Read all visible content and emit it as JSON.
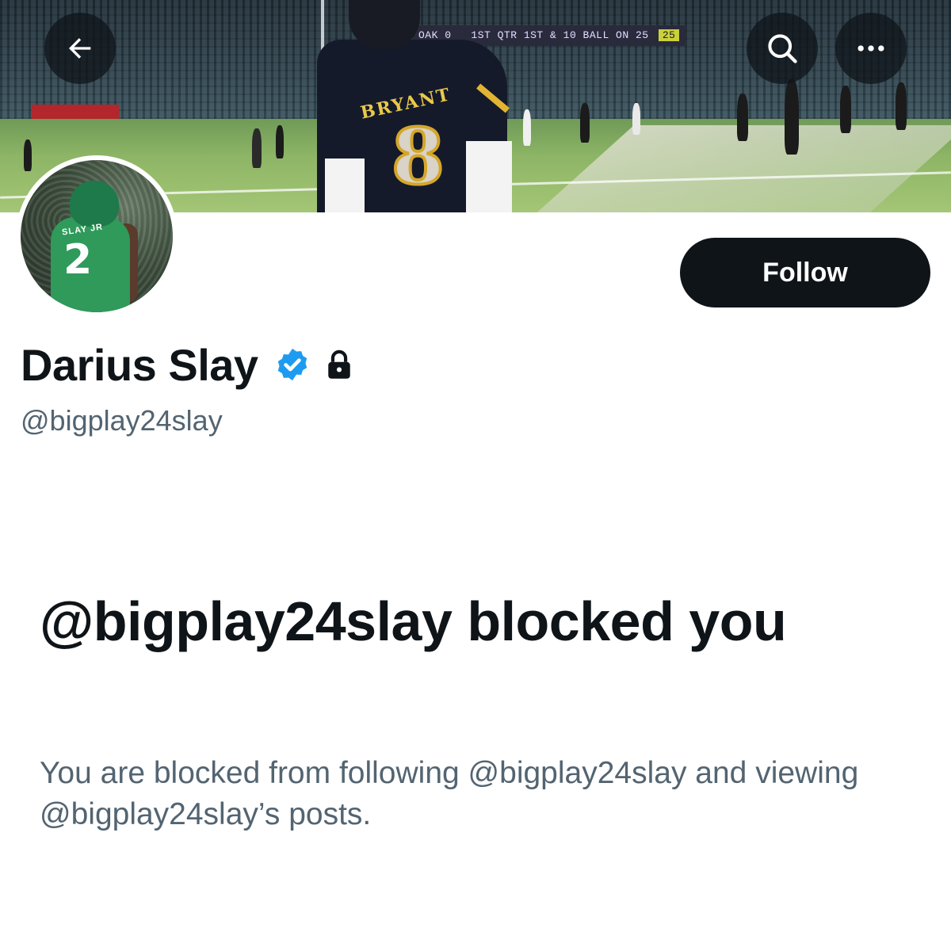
{
  "header": {
    "back_icon": "arrow-left-icon",
    "search_icon": "search-icon",
    "more_icon": "more-horizontal-icon"
  },
  "banner": {
    "scoreboard_left": "OAK 0",
    "scoreboard_text": "1ST QTR  1ST & 10  BALL ON 25",
    "scoreboard_yard": "25",
    "jersey_name": "BRYANT",
    "jersey_number": "8"
  },
  "avatar": {
    "jersey_number": "2",
    "jersey_name": "SLAY JR"
  },
  "profile": {
    "display_name": "Darius Slay",
    "handle": "@bigplay24slay",
    "verified_icon": "verified-badge-icon",
    "lock_icon": "lock-icon",
    "follow_label": "Follow"
  },
  "blocked": {
    "title": "@bigplay24slay blocked you",
    "description": "You are blocked from following @bigplay24slay and viewing @bigplay24slay’s posts."
  },
  "colors": {
    "primary_text": "#0f1419",
    "secondary_text": "#536471",
    "verified_blue": "#1d9bf0",
    "button_bg": "#0f1419"
  }
}
